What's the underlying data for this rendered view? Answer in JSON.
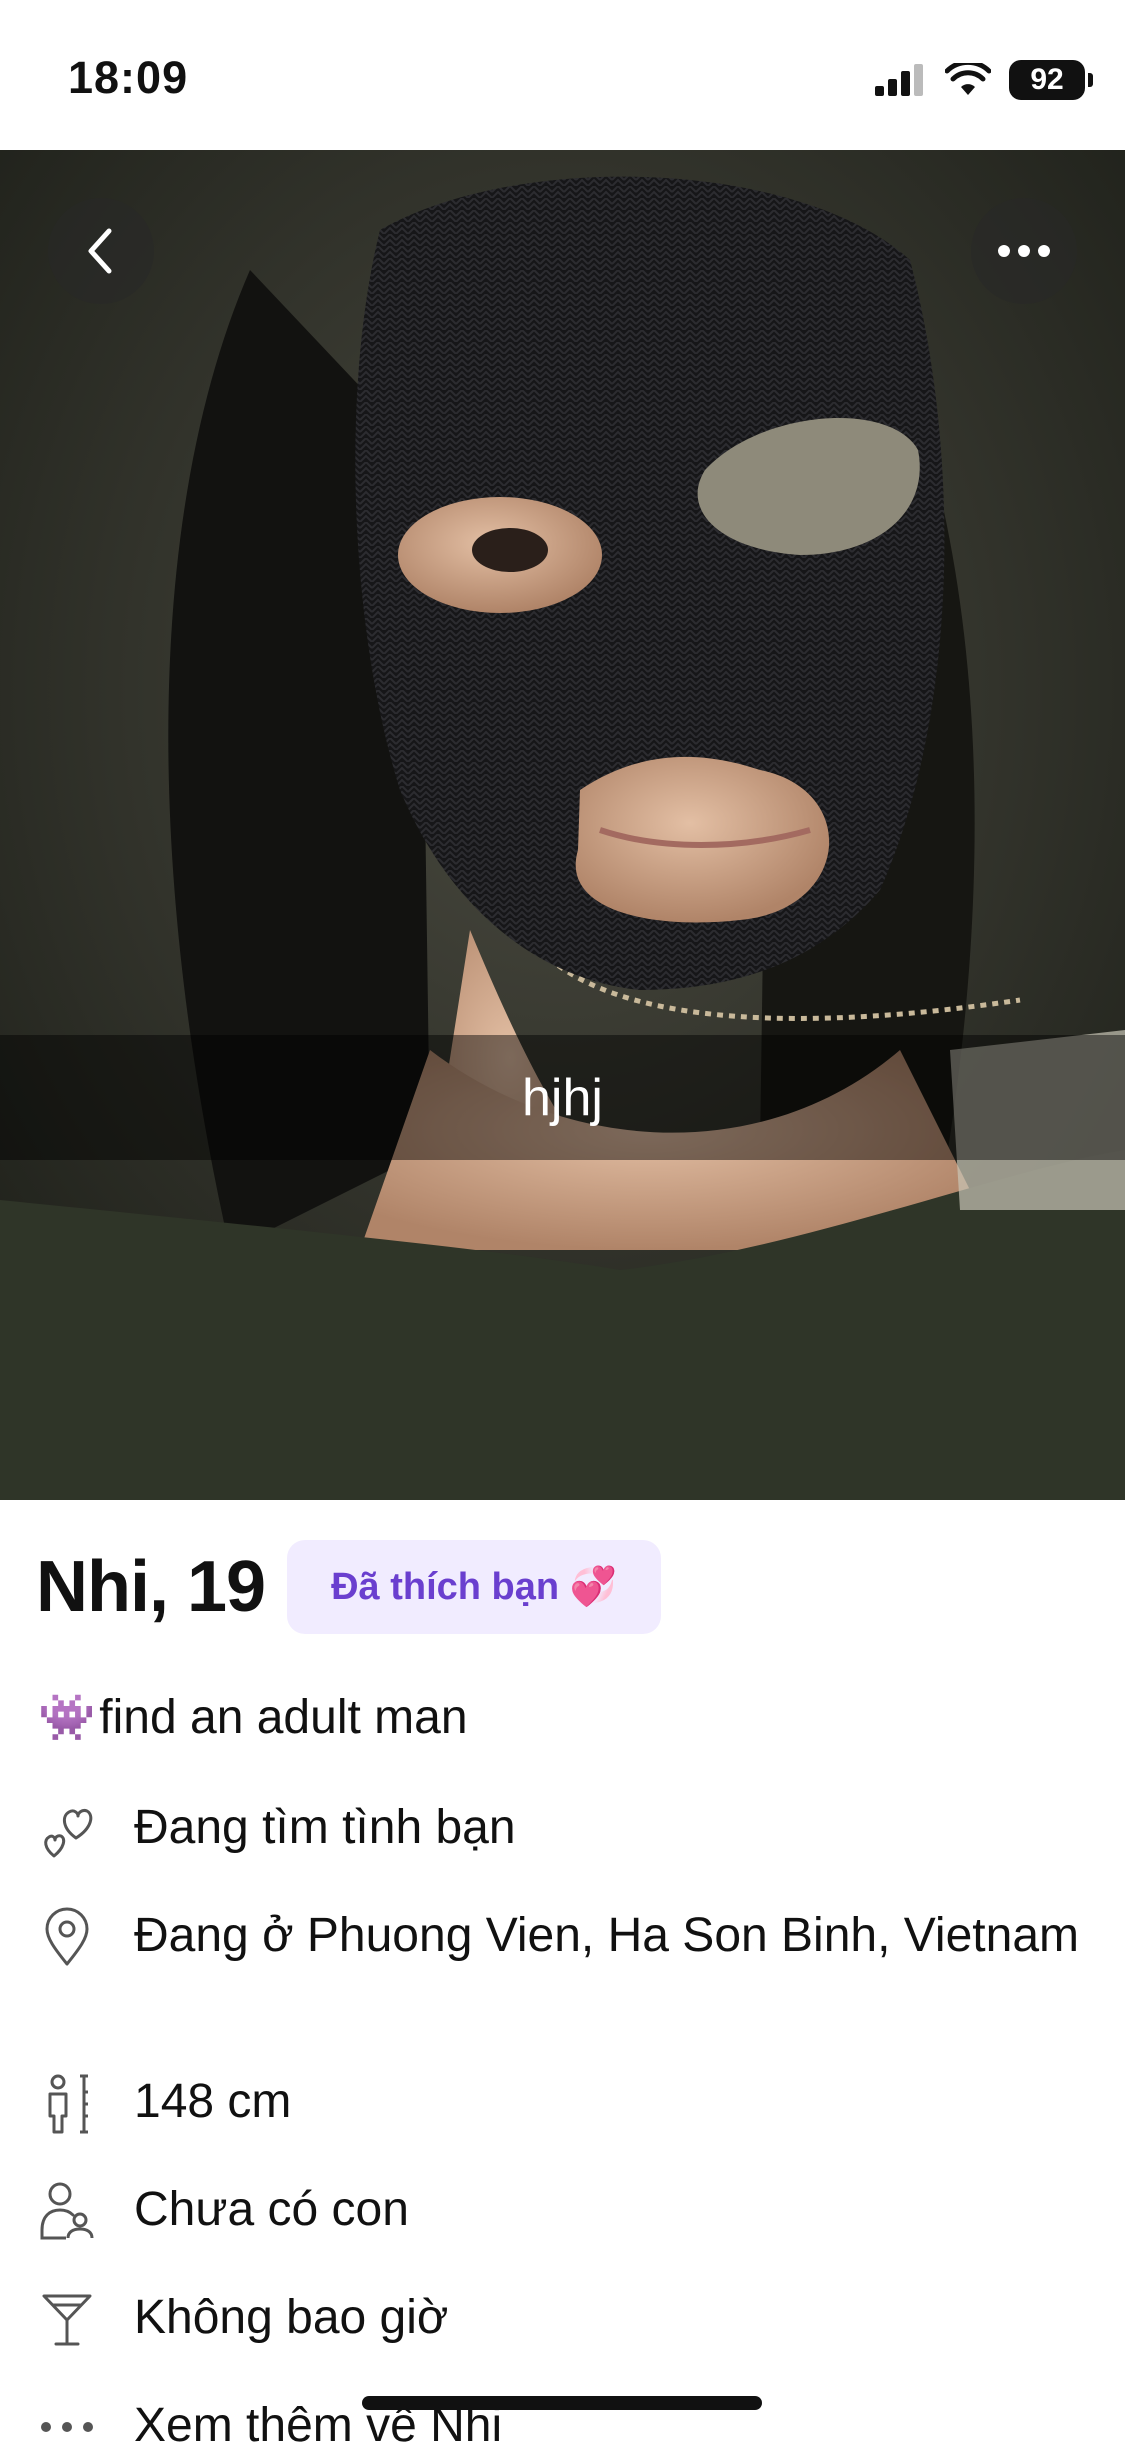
{
  "status_bar": {
    "time": "18:09",
    "battery": "92"
  },
  "photo": {
    "caption": "hjhj"
  },
  "profile": {
    "name_age": "Nhi, 19",
    "liked_badge": "Đã thích bạn 💞",
    "bio_emoji": "👾",
    "bio": "find an adult man",
    "details": [
      {
        "icon": "hearts-icon",
        "text": "Đang tìm tình bạn"
      },
      {
        "icon": "location-pin-icon",
        "text": "Đang ở Phuong Vien, Ha Son Binh, Vietnam"
      },
      {
        "icon": "height-icon",
        "text": "148 cm"
      },
      {
        "icon": "children-icon",
        "text": "Chưa có con"
      },
      {
        "icon": "cocktail-icon",
        "text": "Không bao giờ"
      },
      {
        "icon": "more-dots-icon",
        "text": "Xem thêm về Nhi"
      }
    ]
  },
  "colors": {
    "badge_bg": "#f1ecff",
    "badge_text": "#6a3fcf",
    "caption_bar": "rgba(0,0,0,0.45)"
  }
}
